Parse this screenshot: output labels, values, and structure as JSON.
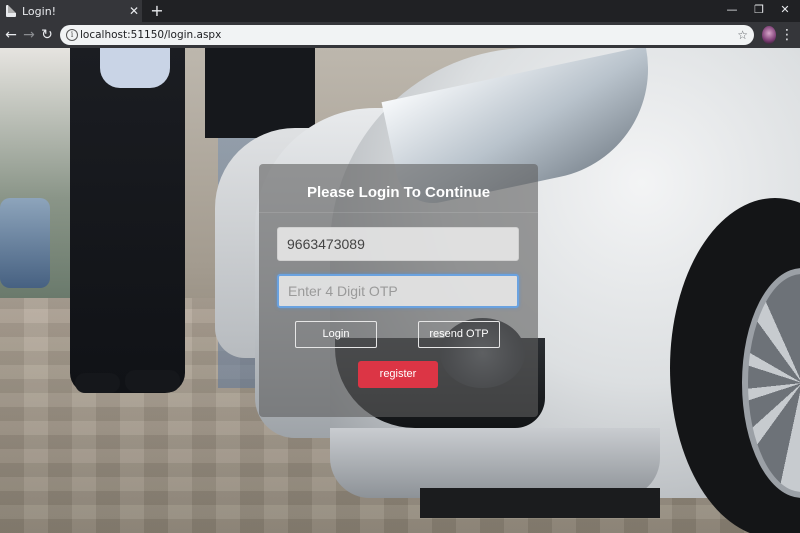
{
  "browser": {
    "tab_title": "Login!",
    "tab_close": "✕",
    "new_tab": "+",
    "url": "localhost:51150/login.aspx",
    "window_controls": {
      "minimize": "—",
      "restore": "❐",
      "close": "✕"
    },
    "nav": {
      "back": "←",
      "forward": "→",
      "reload": "↻"
    },
    "info_glyph": "i",
    "star": "☆",
    "menu": "⋮"
  },
  "login": {
    "title": "Please Login To Continue",
    "phone_value": "9663473089",
    "otp_placeholder": "Enter 4 Digit OTP",
    "login_button": "Login",
    "resend_button": "resend OTP",
    "register_button": "register"
  },
  "colors": {
    "register": "#dc3545",
    "otp_focus_border": "#6aa2e0",
    "panel": "rgba(95,95,95,0.6)"
  }
}
